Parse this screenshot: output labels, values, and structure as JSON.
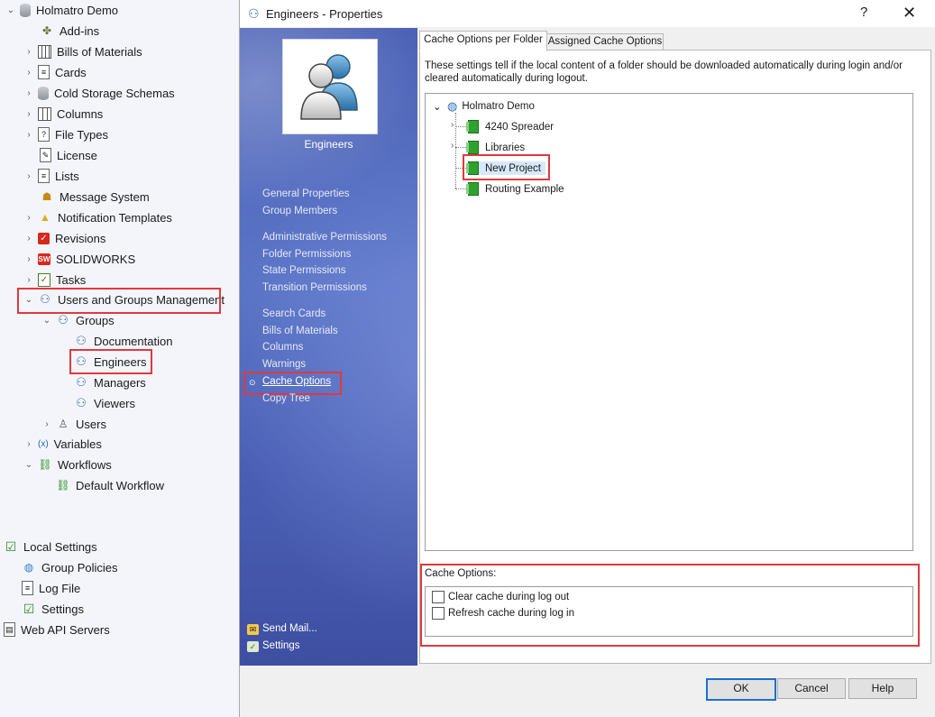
{
  "left_tree": {
    "root": "Holmatro Demo",
    "items": [
      "Add-ins",
      "Bills of Materials",
      "Cards",
      "Cold Storage Schemas",
      "Columns",
      "File Types",
      "License",
      "Lists",
      "Message System",
      "Notification Templates",
      "Revisions",
      "SOLIDWORKS",
      "Tasks",
      "Users and Groups Management"
    ],
    "groups_label": "Groups",
    "groups": [
      "Documentation",
      "Engineers",
      "Managers",
      "Viewers"
    ],
    "users": "Users",
    "variables": "Variables",
    "workflows": "Workflows",
    "default_workflow": "Default Workflow",
    "local_settings": "Local Settings",
    "group_policies": "Group Policies",
    "log_file": "Log File",
    "settings": "Settings",
    "web_api": "Web API Servers"
  },
  "dialog": {
    "title": "Engineers - Properties",
    "help_glyph": "?",
    "close_glyph": "✕",
    "group_name": "Engineers",
    "nav": {
      "general": "General Properties",
      "members": "Group Members",
      "admin_perm": "Administrative Permissions",
      "folder_perm": "Folder Permissions",
      "state_perm": "State Permissions",
      "transition_perm": "Transition Permissions",
      "search_cards": "Search Cards",
      "bom": "Bills of Materials",
      "columns": "Columns",
      "warnings": "Warnings",
      "cache": "Cache Options",
      "copy_tree": "Copy Tree",
      "send_mail": "Send Mail...",
      "settings": "Settings"
    },
    "tabs": {
      "per_folder": "Cache Options per Folder",
      "assigned": "Assigned Cache Options"
    },
    "description": "These settings tell if the local content of a folder should be downloaded automatically during login and/or cleared automatically during logout.",
    "folder_tree": {
      "root": "Holmatro Demo",
      "children": [
        "4240 Spreader",
        "Libraries",
        "New Project",
        "Routing Example"
      ]
    },
    "cache_options_label": "Cache Options:",
    "options": [
      {
        "label": "Clear cache during log out",
        "checked": false
      },
      {
        "label": "Refresh cache during log in",
        "checked": false
      }
    ],
    "buttons": {
      "ok": "OK",
      "cancel": "Cancel",
      "help": "Help"
    }
  },
  "colors": {
    "highlight": "#e0393e",
    "nav_panel": "#4c62b6",
    "folder_green": "#2ea12e"
  }
}
